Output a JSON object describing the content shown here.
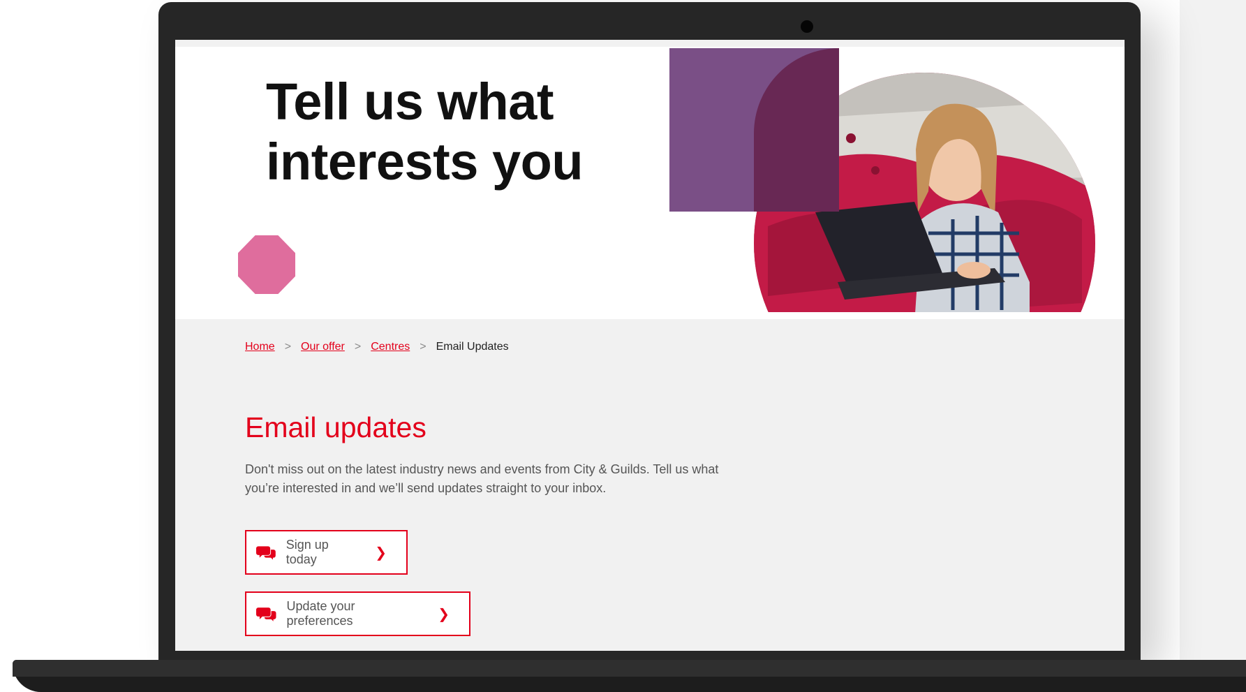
{
  "hero": {
    "title_line1": "Tell us what",
    "title_line2": "interests you"
  },
  "breadcrumb": {
    "items": [
      {
        "label": "Home"
      },
      {
        "label": "Our offer"
      },
      {
        "label": "Centres"
      }
    ],
    "current": "Email Updates",
    "separator": ">"
  },
  "main": {
    "title": "Email updates",
    "intro": "Don't miss out on the latest industry news and events from City & Guilds. Tell us what you’re interested in and we’ll send updates straight to your inbox.",
    "buttons": [
      {
        "label": "Sign up today",
        "icon": "chat-bubbles-icon"
      },
      {
        "label": "Update your preferences",
        "icon": "chat-bubbles-icon"
      }
    ]
  },
  "colors": {
    "accent_red": "#e3001b",
    "purple": "#7a4f86",
    "pink": "#df6d9d",
    "bg_grey": "#f1f1f1"
  }
}
